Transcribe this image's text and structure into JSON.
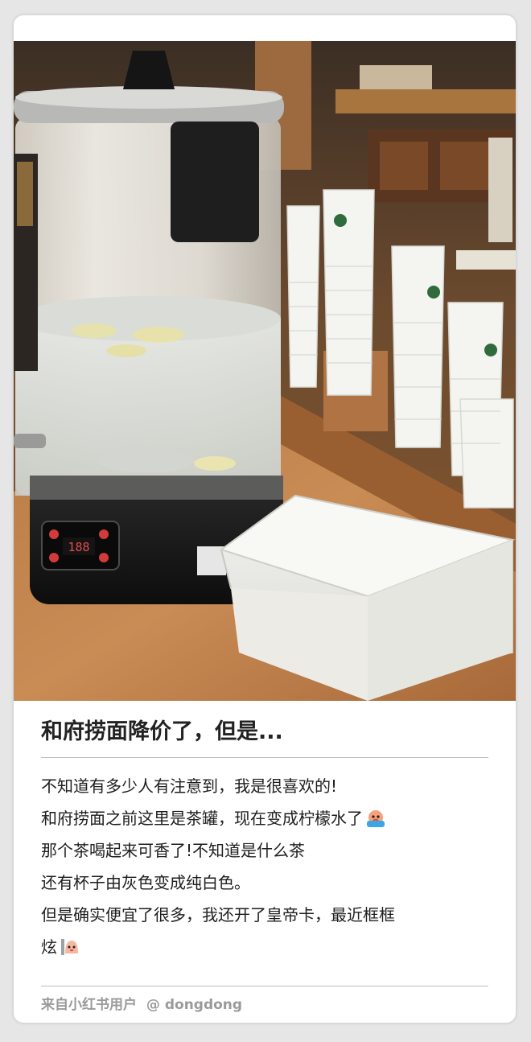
{
  "post": {
    "title": "和府捞面降价了，但是...",
    "body_lines": [
      "不知道有多少人有注意到，我是很喜欢的!",
      "和府捞面之前这里是茶罐，现在变成柠檬水了",
      "那个茶喝起来可香了!不知道是什么茶",
      "还有杯子由灰色变成纯白色。",
      "但是确实便宜了很多，我还开了皇帝卡，最近框框",
      "炫"
    ],
    "line2_emoji": "crying-face-emoji",
    "line6_emoji": "peach-character-emoji"
  },
  "photo": {
    "description_icon": "photo-image",
    "dispenser_display": "188"
  },
  "footer": {
    "source": "来自小红书用户",
    "user": "@ dongdong"
  }
}
